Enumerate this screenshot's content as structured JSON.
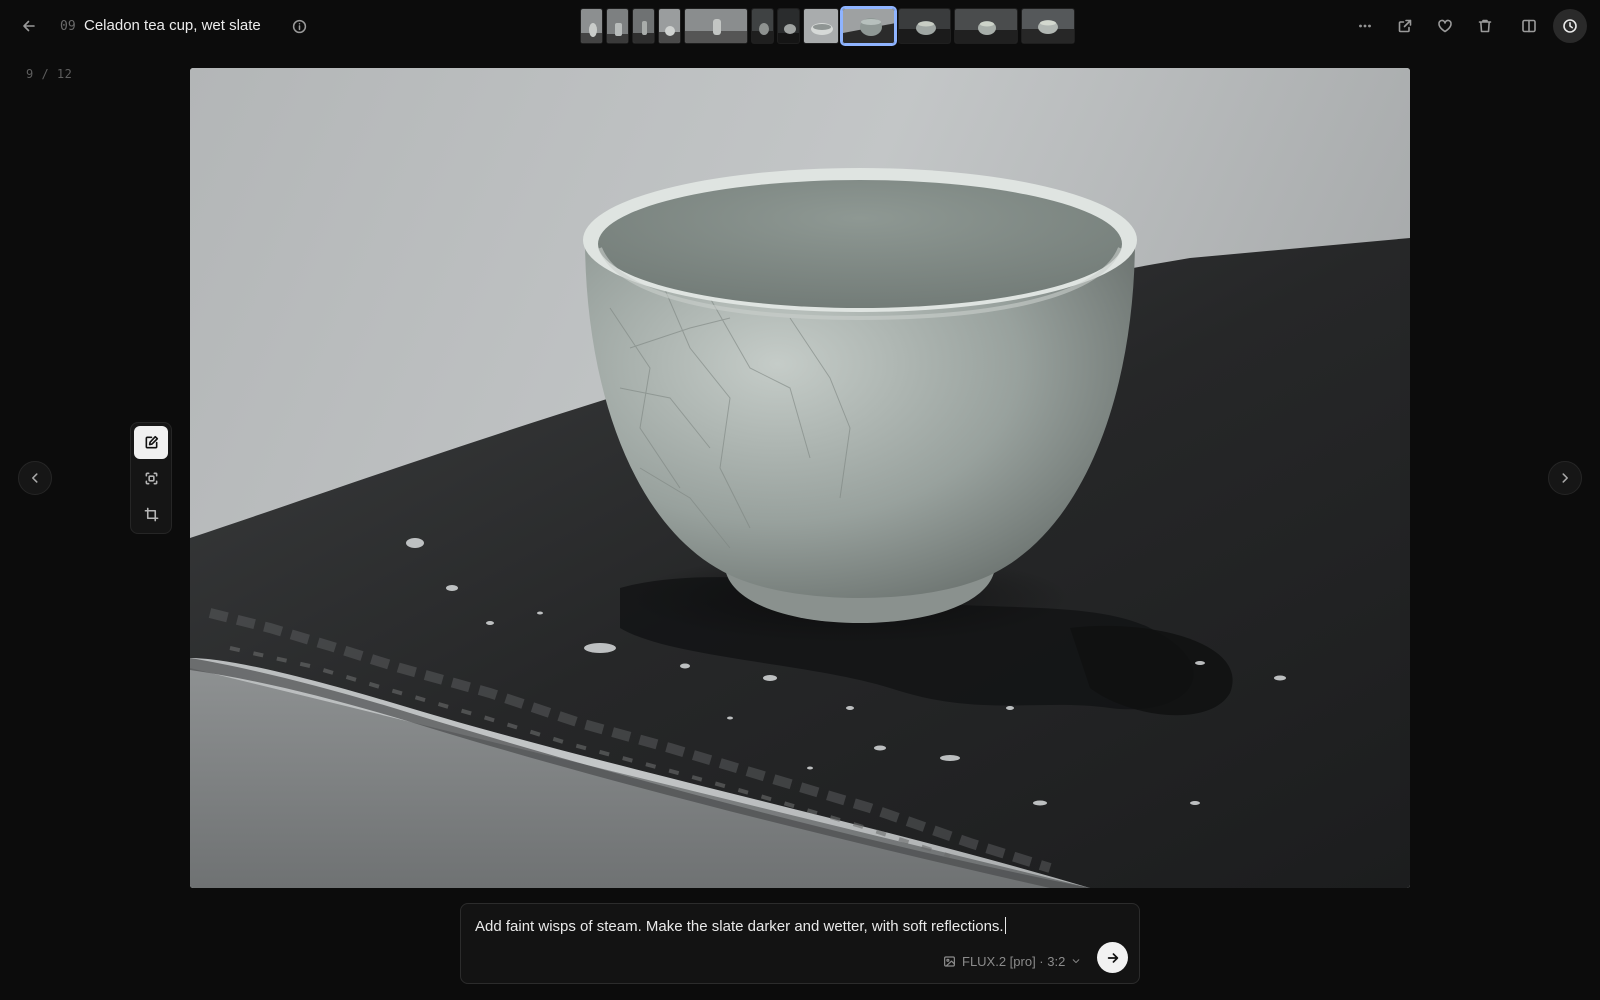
{
  "header": {
    "index": "09",
    "title": "Celadon tea cup, wet slate"
  },
  "icons": {
    "back": "arrow-left-icon",
    "info": "info-icon",
    "more": "ellipsis-icon",
    "open_external": "external-link-icon",
    "favorite": "heart-icon",
    "delete": "trash-icon",
    "compare": "split-view-icon",
    "history": "clock-icon"
  },
  "filmstrip": {
    "active_index": 8,
    "thumbs": [
      {
        "id": "t1"
      },
      {
        "id": "t2"
      },
      {
        "id": "t3"
      },
      {
        "id": "t4"
      },
      {
        "id": "t5"
      },
      {
        "id": "t6"
      },
      {
        "id": "t7"
      },
      {
        "id": "t8"
      },
      {
        "id": "t9"
      },
      {
        "id": "t10"
      },
      {
        "id": "t11"
      },
      {
        "id": "t12"
      }
    ]
  },
  "counter": "9 / 12",
  "tools": {
    "items": [
      {
        "name": "edit",
        "icon": "pencil-square-icon",
        "active": true
      },
      {
        "name": "select",
        "icon": "focus-select-icon",
        "active": false
      },
      {
        "name": "crop",
        "icon": "crop-icon",
        "active": false
      }
    ]
  },
  "prompt": {
    "text": "Add faint wisps of steam. Make the slate darker and wetter, with soft reflections.",
    "model_label": "FLUX.2 [pro] · 3:2"
  },
  "colors": {
    "background": "#0c0c0c",
    "accent": "#8fb4ff",
    "send_button": "#f2f2f2"
  }
}
